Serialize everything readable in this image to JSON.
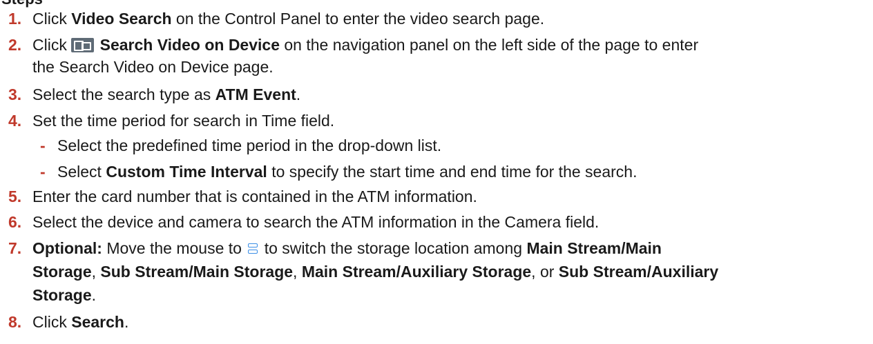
{
  "heading": "Steps",
  "steps": [
    {
      "num": "1.",
      "pre": "Click ",
      "bold1": "Video Search",
      "post": " on the Control Panel to enter the video search page."
    },
    {
      "num": "2.",
      "pre": "Click ",
      "bold1": "Search Video on Device",
      "post": " on the navigation panel on the left side of the page to enter",
      "cont": "the Search Video on Device page.",
      "icon": "search-video-icon"
    },
    {
      "num": "3.",
      "pre": "Select the search type as ",
      "bold1": "ATM Event",
      "post": "."
    },
    {
      "num": "4.",
      "pre": "Set the time period for search in Time field."
    },
    {
      "num": "5.",
      "pre": "Enter the card number that is contained in the ATM information."
    },
    {
      "num": "6.",
      "pre": "Select the device and camera to search the ATM information in the Camera field."
    },
    {
      "num": "7.",
      "bold_lead": "Optional:",
      "pre": " Move the mouse to ",
      "post": " to switch the storage location among ",
      "bold1": "Main Stream/Main",
      "icon": "storage-icon",
      "cont_bold1": "Storage",
      "cont_mid1": ", ",
      "cont_bold2": "Sub Stream/Main Storage",
      "cont_mid2": ", ",
      "cont_bold3": "Main Stream/Auxiliary Storage",
      "cont_mid3": ", or ",
      "cont_bold4": "Sub Stream/Auxiliary",
      "cont2_bold": "Storage",
      "cont2_post": "."
    },
    {
      "num": "8.",
      "pre": "Click ",
      "bold1": "Search",
      "post": "."
    }
  ],
  "substeps": [
    {
      "dash": "-",
      "pre": "Select the predefined time period in the drop-down list."
    },
    {
      "dash": "-",
      "pre": "Select ",
      "bold1": "Custom Time Interval",
      "post": " to specify the start time and end time for the search."
    }
  ]
}
